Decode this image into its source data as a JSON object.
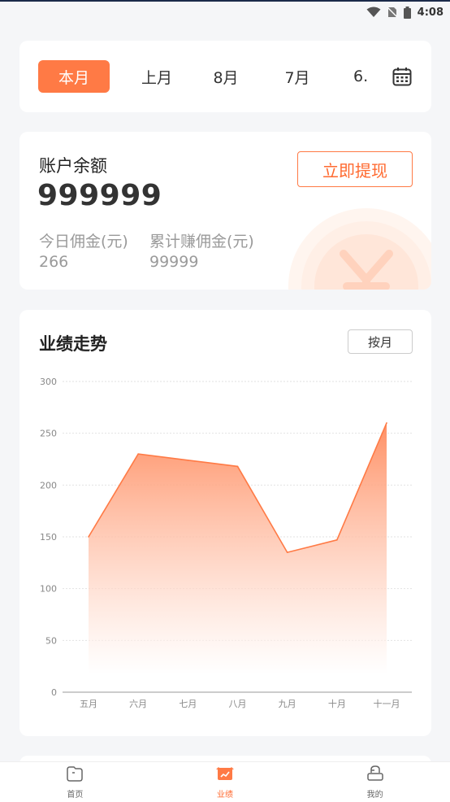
{
  "status_bar": {
    "time": "4:08"
  },
  "month_tabs": [
    {
      "label": "本月",
      "active": true
    },
    {
      "label": "上月",
      "active": false
    },
    {
      "label": "8月",
      "active": false
    },
    {
      "label": "7月",
      "active": false
    },
    {
      "label": "6.",
      "active": false
    }
  ],
  "balance": {
    "title": "账户余额",
    "amount": "999999",
    "withdraw_label": "立即提现",
    "today_label": "今日佣金(元)",
    "today_value": "266",
    "total_label": "累计赚佣金(元)",
    "total_value": "99999"
  },
  "trend": {
    "title": "业绩走势",
    "period_label": "按月"
  },
  "chart_data": {
    "type": "area",
    "categories": [
      "五月",
      "六月",
      "七月",
      "八月",
      "九月",
      "十月",
      "十一月"
    ],
    "values": [
      150,
      230,
      224,
      218,
      135,
      147,
      260
    ],
    "title": "",
    "xlabel": "",
    "ylabel": "",
    "ylim": [
      0,
      300
    ],
    "yticks": [
      0,
      50,
      100,
      150,
      200,
      250,
      300
    ],
    "grid": true,
    "color": "#ff7a45"
  },
  "bottom_nav": [
    {
      "label": "首页",
      "icon": "home-icon",
      "active": false
    },
    {
      "label": "业绩",
      "icon": "performance-icon",
      "active": true
    },
    {
      "label": "我的",
      "icon": "profile-icon",
      "active": false
    }
  ],
  "colors": {
    "accent": "#ff7a45",
    "background": "#f5f6f8"
  }
}
